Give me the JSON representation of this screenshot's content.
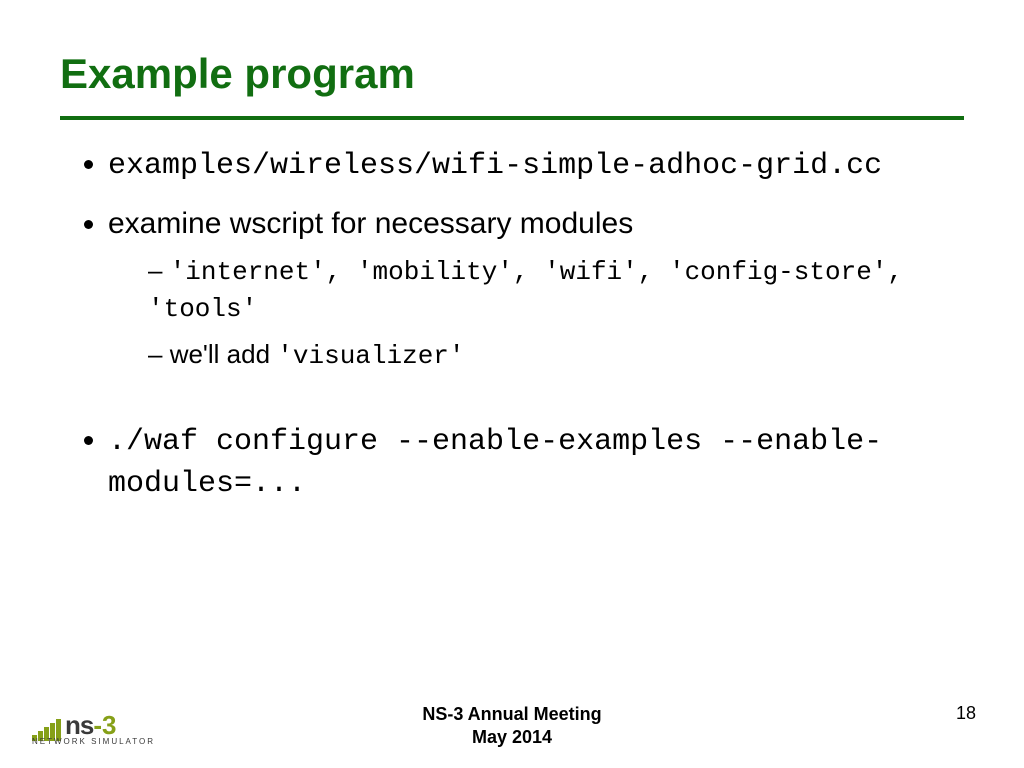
{
  "title": "Example program",
  "bullets": {
    "b1": "examples/wireless/wifi-simple-adhoc-grid.cc",
    "b2": "examine wscript for necessary modules",
    "b2a": "'internet', 'mobility', 'wifi', 'config-store', 'tools'",
    "b2b_prefix": "we'll add ",
    "b2b_code": "'visualizer'",
    "b3": "./waf configure --enable-examples --enable-modules=..."
  },
  "footer": {
    "line1": "NS-3 Annual Meeting",
    "line2": "May 2014",
    "page": "18"
  },
  "logo": {
    "ns": "ns",
    "three": "-3",
    "sub": "NETWORK SIMULATOR"
  }
}
